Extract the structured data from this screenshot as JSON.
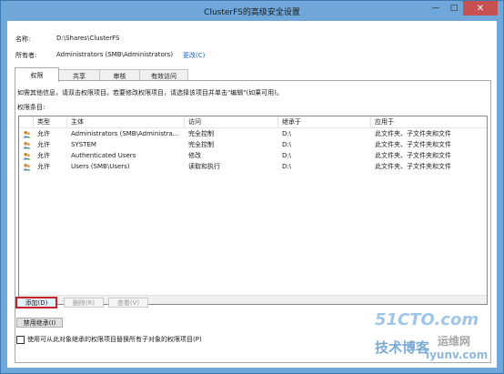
{
  "window": {
    "title": "ClusterFS的高级安全设置"
  },
  "window_controls": {
    "minimize": "—",
    "maximize": "□",
    "close": "✕"
  },
  "name_row": {
    "label": "名称:",
    "value": "D:\\Shares\\ClusterFS"
  },
  "owner_row": {
    "label": "所有者:",
    "value": "Administrators (SMB\\Administrators)",
    "change_link": "更改(C)"
  },
  "tabs": [
    {
      "label": "权限",
      "active": true
    },
    {
      "label": "共享",
      "active": false
    },
    {
      "label": "审核",
      "active": false
    },
    {
      "label": "有效访问",
      "active": false
    }
  ],
  "info_text": "如需其他信息，请双击权限项目。若要修改权限项目，请选择该项目并单击\"编辑\"(如果可用)。",
  "entries_label": "权限条目:",
  "table": {
    "columns": [
      "类型",
      "主体",
      "访问",
      "继承于",
      "应用于"
    ],
    "rows": [
      {
        "type": "允许",
        "principal": "Administrators (SMB\\Administra...",
        "access": "完全控制",
        "inherited": "D:\\",
        "applies": "此文件夹、子文件夹和文件"
      },
      {
        "type": "允许",
        "principal": "SYSTEM",
        "access": "完全控制",
        "inherited": "D:\\",
        "applies": "此文件夹、子文件夹和文件"
      },
      {
        "type": "允许",
        "principal": "Authenticated Users",
        "access": "修改",
        "inherited": "D:\\",
        "applies": "此文件夹、子文件夹和文件"
      },
      {
        "type": "允许",
        "principal": "Users (SMB\\Users)",
        "access": "读取和执行",
        "inherited": "D:\\",
        "applies": "此文件夹、子文件夹和文件"
      }
    ]
  },
  "buttons": {
    "add": "添加(D)",
    "remove": "删除(R)",
    "view": "查看(V)",
    "disable_inheritance": "禁用继承(I)"
  },
  "replace_checkbox": {
    "label": "使用可从此对象继承的权限项目替换所有子对象的权限项目(P)",
    "checked": false
  },
  "watermark": {
    "line1": "51CTO.com",
    "line2": "技术博客",
    "line3": "运维网",
    "line4": "iyunv.com"
  }
}
